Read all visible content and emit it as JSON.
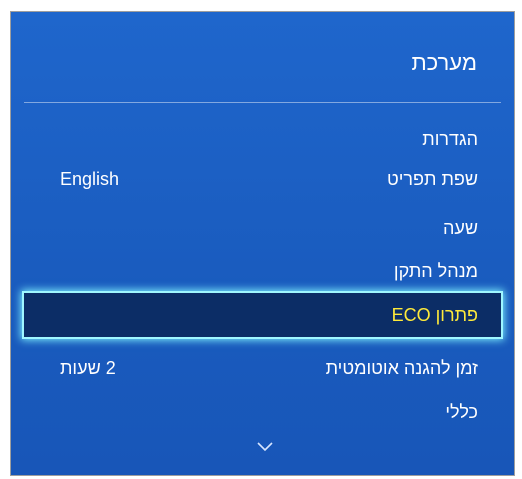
{
  "menu": {
    "title": "מערכת",
    "items": [
      {
        "label": "הגדרות",
        "value": ""
      },
      {
        "label": "שפת תפריט",
        "value": "English"
      },
      {
        "label": "שעה",
        "value": ""
      },
      {
        "label": "מנהל התקן",
        "value": ""
      },
      {
        "label": "פתרון ECO",
        "value": "",
        "selected": true
      },
      {
        "label": "זמן להגנה אוטומטית",
        "value": "2 שעות"
      },
      {
        "label": "כללי",
        "value": ""
      }
    ],
    "scroll_indicator_icon": "chevron-down-icon"
  },
  "colors": {
    "panel_blue": "#1b5fc4",
    "selected_bg": "#0c2d66",
    "selected_text": "#ffea3a",
    "focus_glow": "#9ff7ff"
  }
}
